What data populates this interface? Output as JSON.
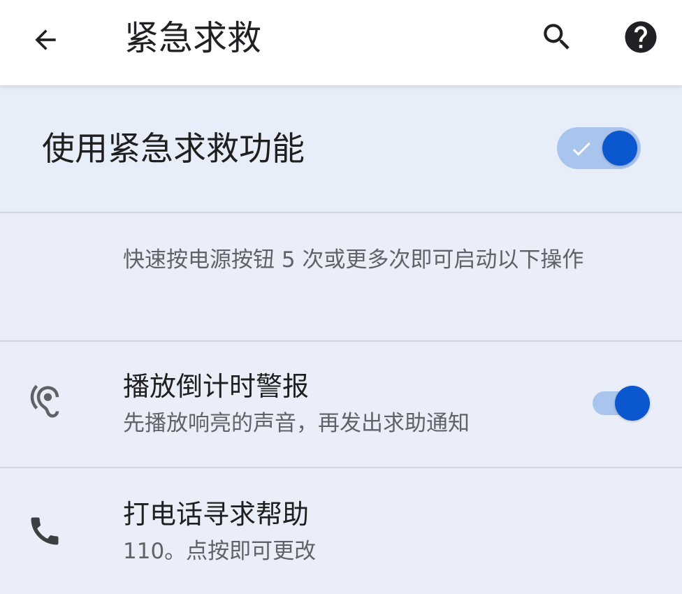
{
  "app_bar": {
    "title": "紧急求救",
    "back_icon": "arrow-back-icon",
    "search_icon": "search-icon",
    "help_icon": "help-icon"
  },
  "main_switch": {
    "label": "使用紧急求救功能",
    "checked": true
  },
  "description": "快速按电源按钮 5 次或更多次即可启动以下操作",
  "settings": [
    {
      "icon": "hearing-icon",
      "title": "播放倒计时警报",
      "summary": "先播放响亮的声音，再发出求助通知",
      "checked": true
    },
    {
      "icon": "phone-icon",
      "title": "打电话寻求帮助",
      "summary": "110。点按即可更改"
    }
  ],
  "colors": {
    "accent": "#0b57d0",
    "track": "#a9c5ee",
    "background": "#e9eef8",
    "appbar": "#ffffff"
  }
}
